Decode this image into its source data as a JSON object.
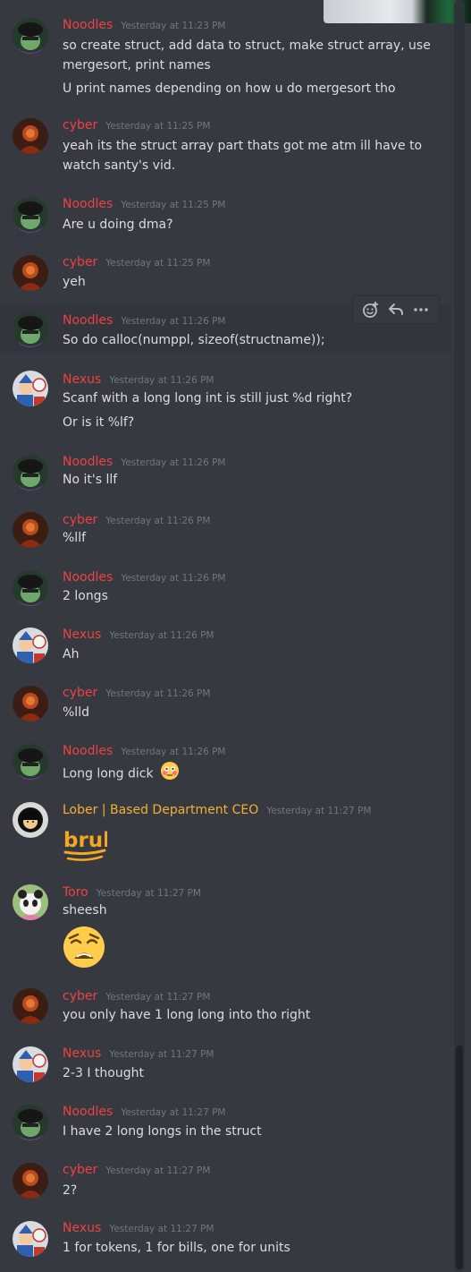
{
  "colors": {
    "noodles": "#ed4245",
    "cyber": "#ed4245",
    "nexus": "#ed4245",
    "lober": "#f0b232",
    "toro": "#ed4245"
  },
  "toolbar": {
    "add_reaction_icon": "add-reaction-icon",
    "reply_icon": "reply-icon",
    "more_icon": "more-icon"
  },
  "messages": [
    {
      "author": "Noodles",
      "time": "Yesterday at 11:23 PM",
      "lines": [
        "so create struct, add data to struct, make struct array, use",
        "mergesort, print names",
        "U print names depending on how u do mergesort tho"
      ]
    },
    {
      "author": "cyber",
      "time": "Yesterday at 11:25 PM",
      "lines": [
        "yeah its the struct array part thats got me atm ill have to",
        "watch santy's vid."
      ]
    },
    {
      "author": "Noodles",
      "time": "Yesterday at 11:25 PM",
      "lines": [
        "Are u doing dma?"
      ]
    },
    {
      "author": "cyber",
      "time": "Yesterday at 11:25 PM",
      "lines": [
        "yeh"
      ]
    },
    {
      "author": "Noodles",
      "time": "Yesterday at 11:26 PM",
      "lines": [
        "So do calloc(numppl, sizeof(structname));"
      ]
    },
    {
      "author": "Nexus",
      "time": "Yesterday at 11:26 PM",
      "lines": [
        "Scanf with a long long int is still just %d right?",
        "Or is it %lf?"
      ]
    },
    {
      "author": "Noodles",
      "time": "Yesterday at 11:26 PM",
      "lines": [
        "No it's llf"
      ]
    },
    {
      "author": "cyber",
      "time": "Yesterday at 11:26 PM",
      "lines": [
        "%llf"
      ]
    },
    {
      "author": "Noodles",
      "time": "Yesterday at 11:26 PM",
      "lines": [
        "2 longs"
      ]
    },
    {
      "author": "Nexus",
      "time": "Yesterday at 11:26 PM",
      "lines": [
        "Ah"
      ]
    },
    {
      "author": "cyber",
      "time": "Yesterday at 11:26 PM",
      "lines": [
        "%lld"
      ]
    },
    {
      "author": "Noodles",
      "time": "Yesterday at 11:26 PM",
      "lines": [
        "Long long dick"
      ]
    },
    {
      "author": "Lober | Based Department CEO",
      "time": "Yesterday at 11:27 PM",
      "sticker": "bruh"
    },
    {
      "author": "Toro",
      "time": "Yesterday at 11:27 PM",
      "lines": [
        "sheesh"
      ]
    },
    {
      "author": "cyber",
      "time": "Yesterday at 11:27 PM",
      "lines": [
        "you only have 1 long long into tho right"
      ]
    },
    {
      "author": "Nexus",
      "time": "Yesterday at 11:27 PM",
      "lines": [
        "2-3 I thought"
      ]
    },
    {
      "author": "Noodles",
      "time": "Yesterday at 11:27 PM",
      "lines": [
        "I have 2 long longs in the struct"
      ]
    },
    {
      "author": "cyber",
      "time": "Yesterday at 11:27 PM",
      "lines": [
        "2?"
      ]
    },
    {
      "author": "Nexus",
      "time": "Yesterday at 11:27 PM",
      "lines": [
        "1 for tokens, 1 for bills, one for units"
      ]
    }
  ]
}
